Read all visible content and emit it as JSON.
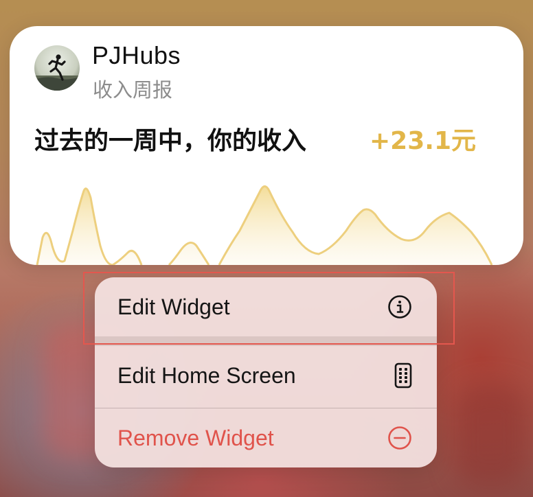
{
  "widget": {
    "app_name": "PJHubs",
    "subtitle": "收入周报",
    "summary_text": "过去的一周中，你的收入",
    "amount": "+23.1元",
    "accent_color": "#e2b649"
  },
  "menu": {
    "items": [
      {
        "label": "Edit Widget",
        "icon": "info-circle-icon"
      },
      {
        "label": "Edit Home Screen",
        "icon": "phone-grid-icon"
      },
      {
        "label": "Remove Widget",
        "icon": "minus-circle-icon",
        "color": "#e0534b"
      }
    ]
  },
  "highlight_color": "#e4574e"
}
